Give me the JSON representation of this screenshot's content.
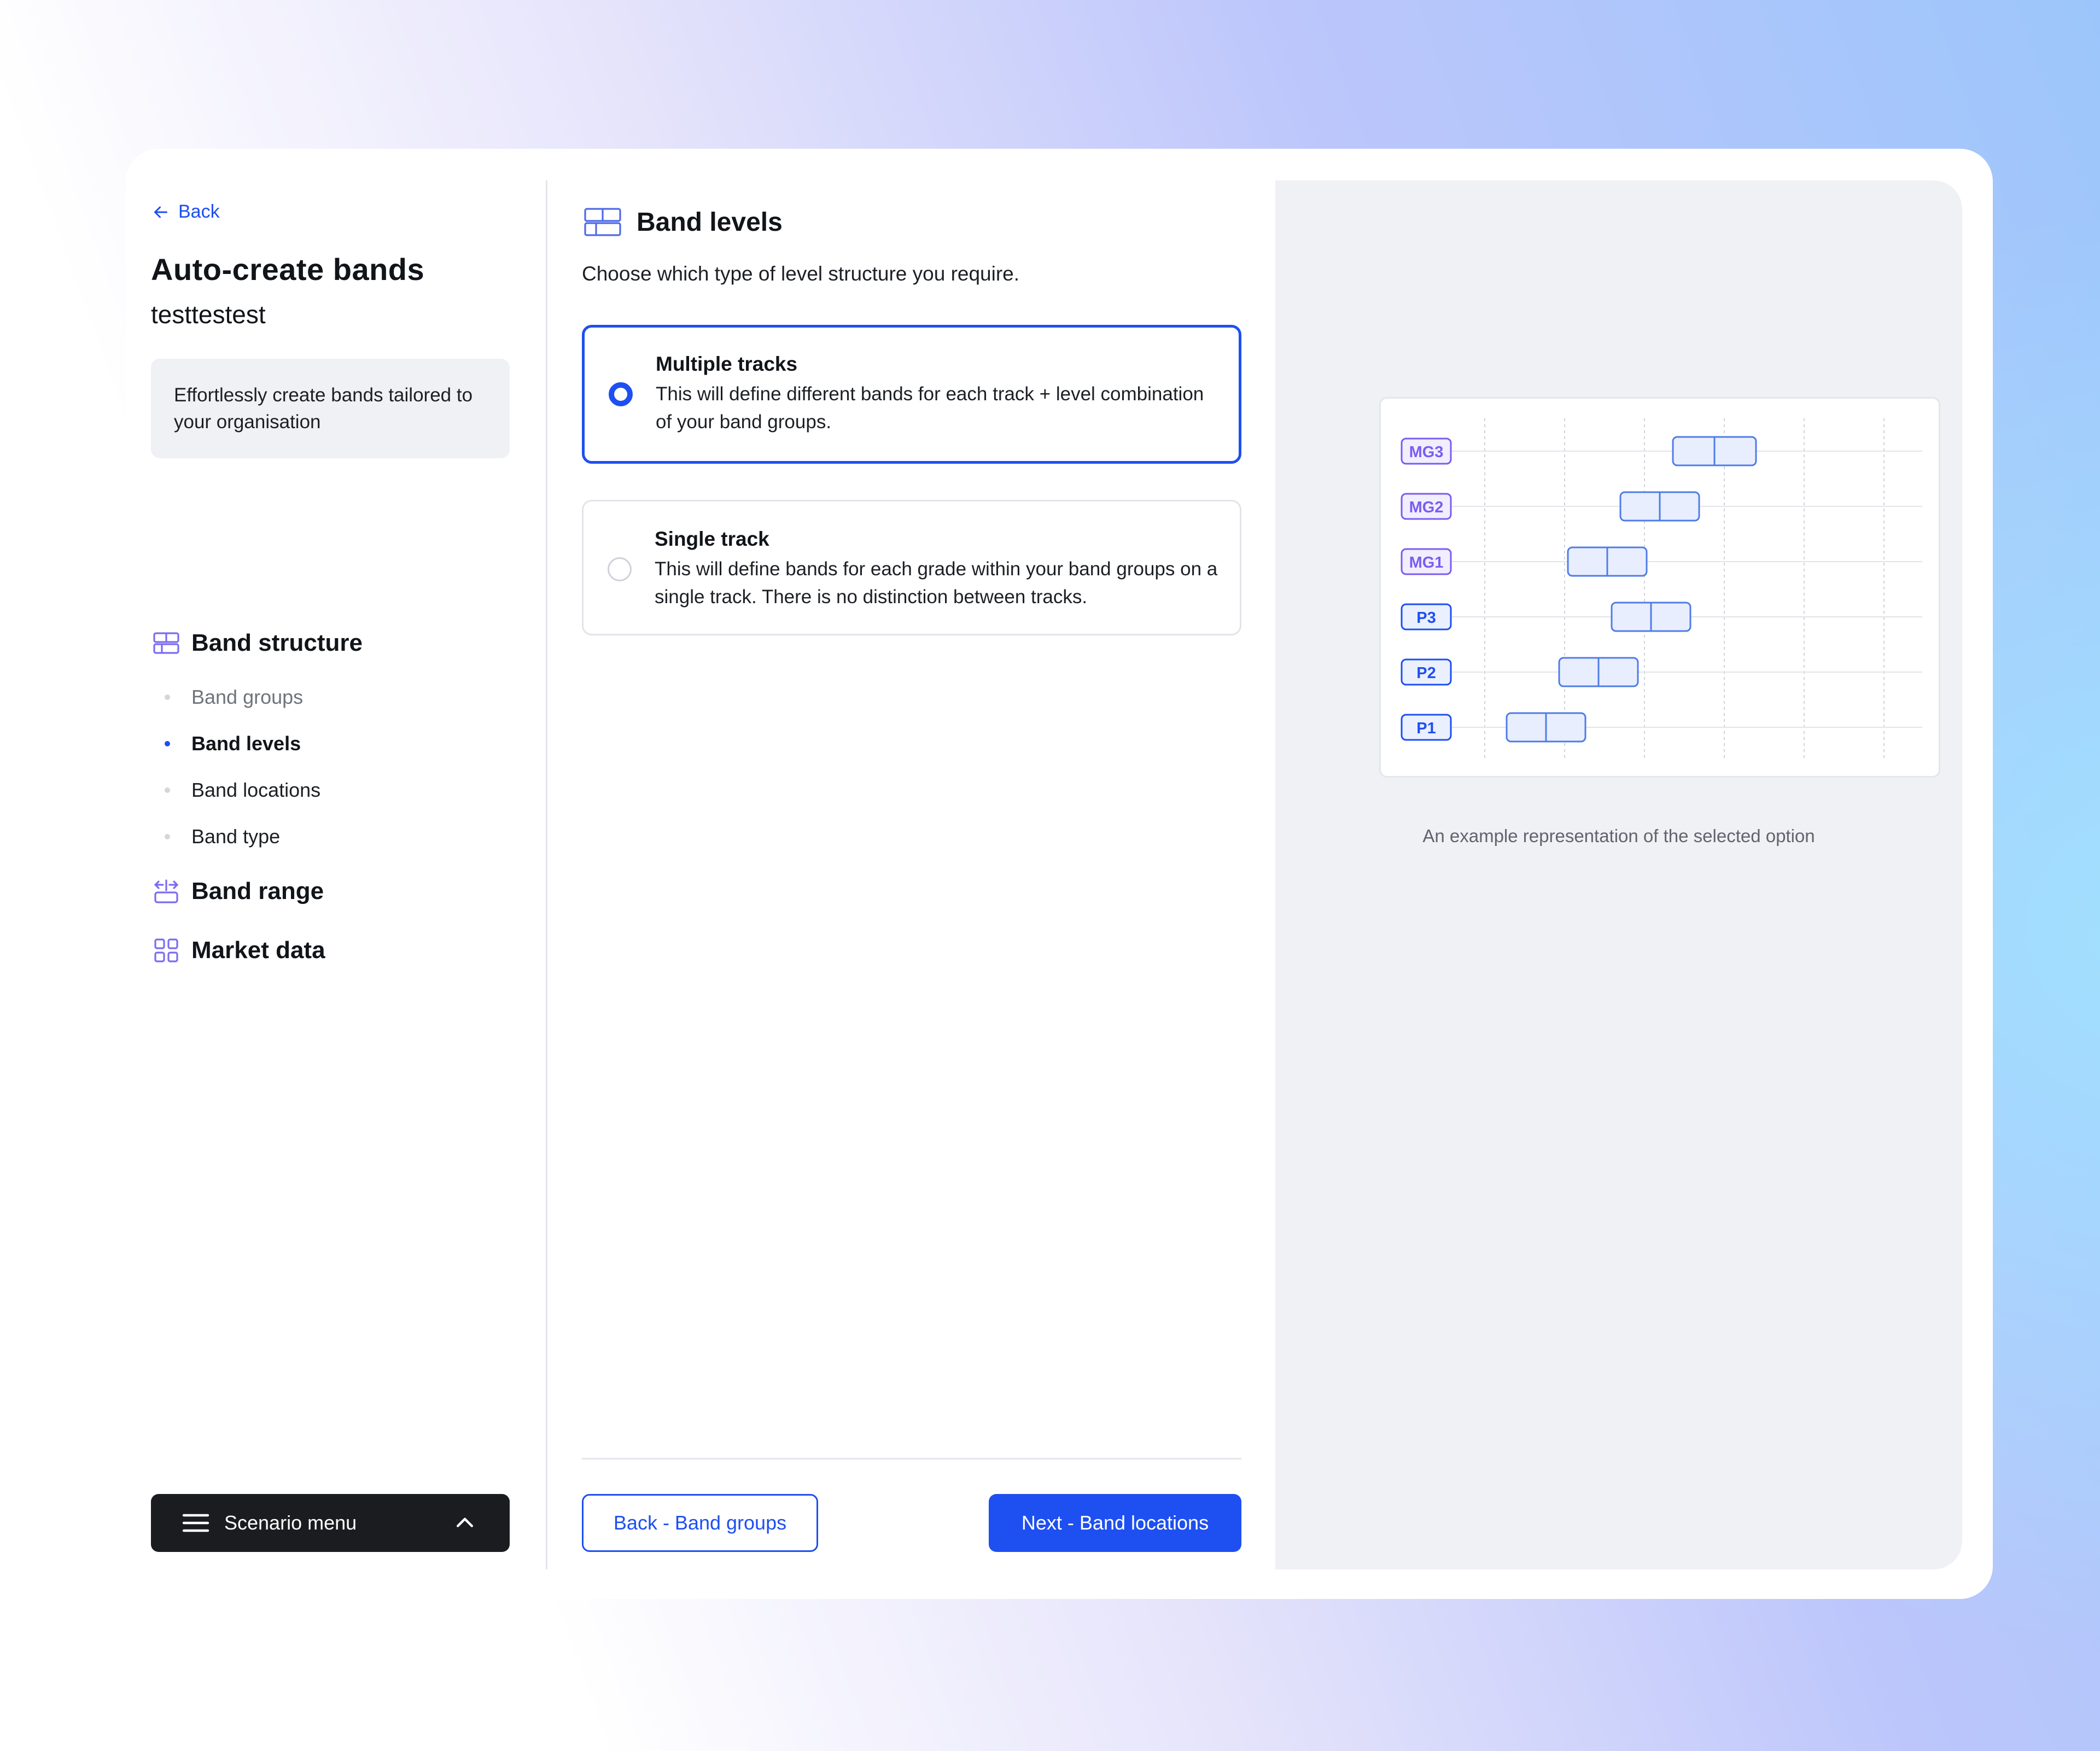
{
  "sidebar": {
    "back_label": "Back",
    "title": "Auto-create bands",
    "subtitle": "testtestest",
    "info": "Effortlessly create bands tailored to your organisation",
    "sections": [
      {
        "label": "Band structure",
        "icon": "band-structure-icon"
      },
      {
        "label": "Band range",
        "icon": "band-range-icon"
      },
      {
        "label": "Market data",
        "icon": "grid-icon"
      }
    ],
    "structure_items": [
      {
        "label": "Band groups",
        "state": "done"
      },
      {
        "label": "Band levels",
        "state": "active"
      },
      {
        "label": "Band locations",
        "state": "pending"
      },
      {
        "label": "Band type",
        "state": "pending"
      }
    ],
    "scenario_menu": "Scenario menu"
  },
  "main": {
    "title": "Band levels",
    "description": "Choose which type of level structure you require.",
    "options": [
      {
        "title": "Multiple tracks",
        "text": "This will define different bands for each track + level combination of your band groups.",
        "selected": true
      },
      {
        "title": "Single track",
        "text": "This will define bands for each grade within your band groups on a single track. There is no distinction between tracks.",
        "selected": false
      }
    ],
    "back_button": "Back - Band groups",
    "next_button": "Next - Band locations"
  },
  "preview": {
    "caption": "An example representation of the selected option",
    "rows": [
      {
        "label": "MG3",
        "group": "management",
        "start": 0.43,
        "end": 0.62
      },
      {
        "label": "MG2",
        "group": "management",
        "start": 0.31,
        "end": 0.49
      },
      {
        "label": "MG1",
        "group": "management",
        "start": 0.19,
        "end": 0.37
      },
      {
        "label": "P3",
        "group": "professional",
        "start": 0.29,
        "end": 0.47
      },
      {
        "label": "P2",
        "group": "professional",
        "start": 0.17,
        "end": 0.35
      },
      {
        "label": "P1",
        "group": "professional",
        "start": 0.05,
        "end": 0.23
      }
    ],
    "colors": {
      "management": "#7b5cf0",
      "professional": "#1e4ff0",
      "band_fill": "#e8eefd",
      "band_stroke": "#4f7ce8"
    }
  },
  "colors": {
    "accent": "#1e4ff0",
    "dark": "#1b1c1f",
    "panel": "#f0f1f5"
  }
}
